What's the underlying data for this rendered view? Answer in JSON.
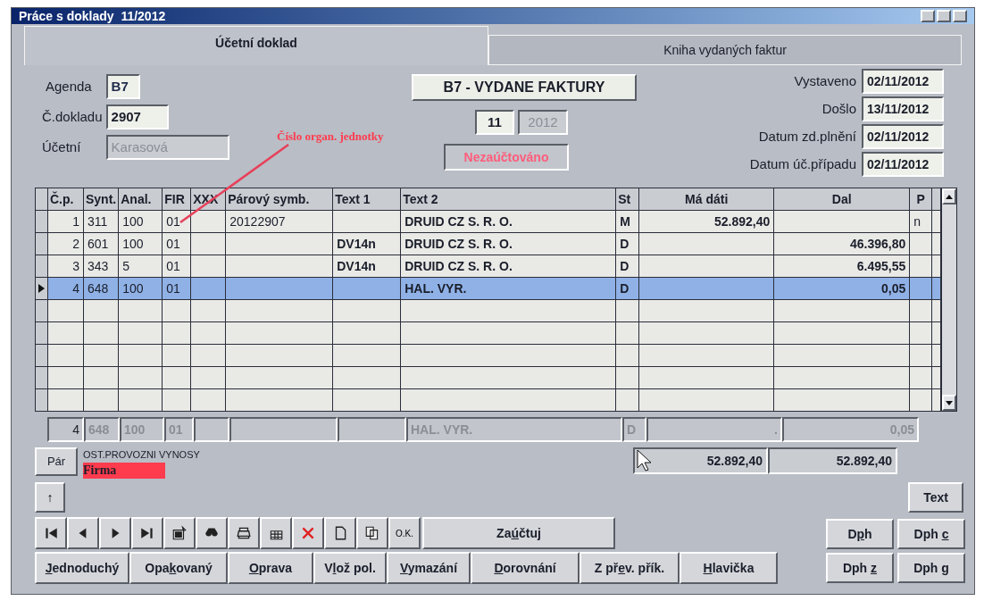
{
  "window": {
    "title": "Práce s doklady  11/2012"
  },
  "tabs": [
    {
      "label": "Účetní doklad",
      "selected": true
    },
    {
      "label": "Kniha vydaných faktur",
      "selected": false
    }
  ],
  "form": {
    "agenda": {
      "label": "Agenda",
      "value": "B7"
    },
    "doklad": {
      "label": "Č.dokladu",
      "value": "2907"
    },
    "ucetni": {
      "label": "Účetní",
      "value": "Karasová",
      "disabled": true
    },
    "book": "B7 - VYDANE FAKTURY",
    "month": "11",
    "year": {
      "value": "2012",
      "disabled": true
    },
    "status": "Nezaúčtováno",
    "dates": [
      {
        "label": "Vystaveno",
        "value": "02/11/2012"
      },
      {
        "label": "Došlo",
        "value": "13/11/2012"
      },
      {
        "label": "Datum zd.plnění",
        "value": "02/11/2012"
      },
      {
        "label": "Datum úč.případu",
        "value": "02/11/2012"
      }
    ]
  },
  "annotation": {
    "text": "Číslo organ. jednotky"
  },
  "table": {
    "columns": [
      "Č.p.",
      "Synt.",
      "Anal.",
      "FIR",
      "XXX",
      "Párový symb.",
      "Text 1",
      "Text 2",
      "St",
      "Má dáti",
      "Dal",
      "P"
    ],
    "rows": [
      {
        "selected": false,
        "cells": {
          "cp": "1",
          "synt": "311",
          "anal": "100",
          "fir": "01",
          "par": "20122907",
          "text_2": "DRUID CZ S. R. O.",
          "st": "M",
          "ma_dati": "52.892,40",
          "p": "n"
        }
      },
      {
        "selected": false,
        "cells": {
          "cp": "2",
          "synt": "601",
          "anal": "100",
          "fir": "01",
          "text_1": "DV14n",
          "text_2": "DRUID CZ S. R. O.",
          "st": "D",
          "dal": "46.396,80"
        }
      },
      {
        "selected": false,
        "cells": {
          "cp": "3",
          "synt": "343",
          "anal": "5",
          "fir": "01",
          "text_1": "DV14n",
          "text_2": "DRUID CZ S. R. O.",
          "st": "D",
          "dal": "6.495,55"
        }
      },
      {
        "selected": true,
        "cells": {
          "cp": "4",
          "synt": "648",
          "anal": "100",
          "fir": "01",
          "text_2": "HAL. VYR.",
          "st": "D",
          "dal": "0,05"
        }
      }
    ]
  },
  "current_row": {
    "cp": "4",
    "synt": "648",
    "anal": "100",
    "fir": "01",
    "text_2": "HAL. VYR.",
    "st": "D",
    "ma_dati": ".",
    "dal": "0,05"
  },
  "totals": {
    "ma_dati": "52.892,40",
    "dal": "52.892,40"
  },
  "account_name": "OST.PROVOZNI VYNOSY",
  "firma_label": "Firma",
  "buttons": {
    "par": "Pár",
    "up": "↑",
    "text": "Text",
    "ok": "O.K.",
    "post": {
      "pre": "Za",
      "key": "ú",
      "post": "čtuj"
    },
    "bottom": [
      {
        "key": "J",
        "post": "ednoduchý"
      },
      {
        "pre": "Opa",
        "key": "k",
        "post": "ovaný"
      },
      {
        "key": "O",
        "post": "prava"
      },
      {
        "pre": "V",
        "key": "l",
        "post": "ož pol."
      },
      {
        "key": "V",
        "post": "ymazání"
      },
      {
        "key": "D",
        "post": "orovnání"
      },
      {
        "pre": "Z př",
        "key": "e",
        "post": "v. přík."
      },
      {
        "key": "H",
        "post": "lavička"
      }
    ],
    "dph": [
      {
        "pre": "D",
        "key": "p",
        "post": "h"
      },
      {
        "pre": "Dph ",
        "key": "c"
      },
      {
        "pre": "Dph ",
        "key": "z"
      },
      {
        "pre": "Dph ",
        "key": "g"
      }
    ]
  }
}
